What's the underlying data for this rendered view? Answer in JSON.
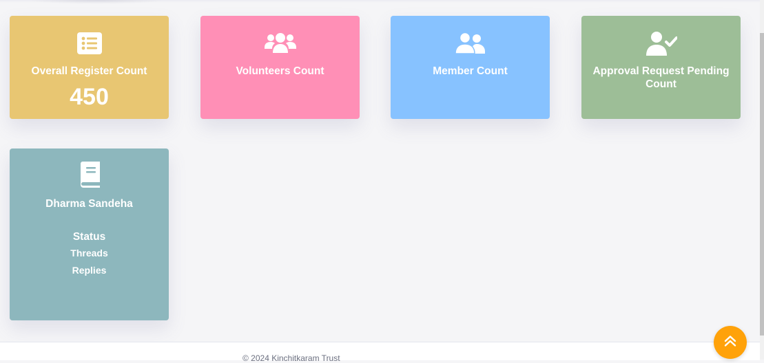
{
  "cards": [
    {
      "id": "register",
      "title": "Overall Register Count",
      "count": "450",
      "icon": "list-alt-icon",
      "color": "#e8c672"
    },
    {
      "id": "volunteers",
      "title": "Volunteers Count",
      "count": "",
      "icon": "users-icon",
      "color": "#ff8fb6"
    },
    {
      "id": "members",
      "title": "Member Count",
      "count": "",
      "icon": "user-friends-icon",
      "color": "#87c2ff"
    },
    {
      "id": "approval",
      "title": "Approval Request Pending Count",
      "count": "",
      "icon": "user-check-icon",
      "color": "#9dbe97"
    }
  ],
  "dharma": {
    "title": "Dharma Sandeha",
    "icon": "book-icon",
    "color": "#8db7bd",
    "status_label": "Status",
    "threads_label": "Threads",
    "replies_label": "Replies"
  },
  "footer": {
    "copyright": "© 2024 Kinchitkaram Trust"
  },
  "scroll_top": {
    "icon": "double-chevron-up-icon",
    "color": "#ffa20a"
  }
}
